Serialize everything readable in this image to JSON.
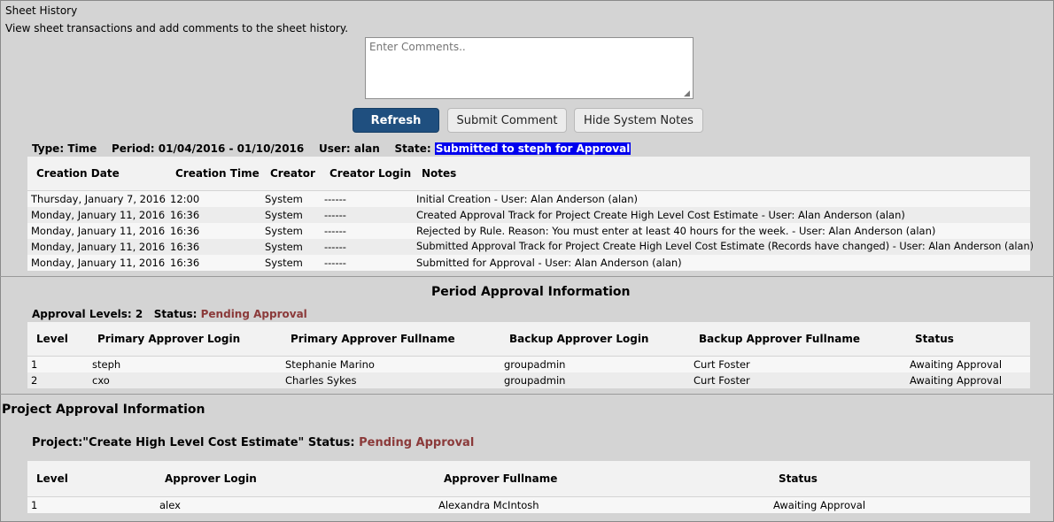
{
  "header": {
    "title": "Sheet History",
    "subtitle": "View sheet transactions and add comments to the sheet history."
  },
  "comment_box": {
    "placeholder": "Enter Comments.."
  },
  "buttons": {
    "refresh": "Refresh",
    "submit_comment": "Submit Comment",
    "hide_system_notes": "Hide System Notes"
  },
  "sheet_info": {
    "type_label": "Type:",
    "type_value": "Time",
    "period_label": "Period:",
    "period_value": "01/04/2016 - 01/10/2016",
    "user_label": "User:",
    "user_value": "alan",
    "state_label": "State:",
    "state_value": "Submitted to steph for Approval"
  },
  "history_table": {
    "headers": [
      "Creation Date",
      "Creation Time",
      "Creator",
      "Creator Login",
      "Notes"
    ],
    "rows": [
      [
        "Thursday, January 7, 2016",
        "12:00",
        "System",
        "------",
        "Initial Creation - User: Alan Anderson (alan)"
      ],
      [
        "Monday, January 11, 2016",
        "16:36",
        "System",
        "------",
        "Created Approval Track for Project Create High Level Cost Estimate - User: Alan Anderson (alan)"
      ],
      [
        "Monday, January 11, 2016",
        "16:36",
        "System",
        "------",
        "Rejected by Rule. Reason: You must enter at least 40 hours for the week. - User: Alan Anderson (alan)"
      ],
      [
        "Monday, January 11, 2016",
        "16:36",
        "System",
        "------",
        "Submitted Approval Track for Project Create High Level Cost Estimate (Records have changed) - User: Alan Anderson (alan)"
      ],
      [
        "Monday, January 11, 2016",
        "16:36",
        "System",
        "------",
        "Submitted for Approval - User: Alan Anderson (alan)"
      ]
    ]
  },
  "period_approval": {
    "title": "Period Approval Information",
    "levels_label": "Approval Levels:",
    "levels_value": "2",
    "status_label": "Status:",
    "status_value": "Pending Approval",
    "headers": [
      "Level",
      "Primary Approver Login",
      "Primary Approver Fullname",
      "Backup Approver Login",
      "Backup Approver Fullname",
      "Status"
    ],
    "rows": [
      [
        "1",
        "steph",
        "Stephanie Marino",
        "groupadmin",
        "Curt Foster",
        "Awaiting Approval"
      ],
      [
        "2",
        "cxo",
        "Charles Sykes",
        "groupadmin",
        "Curt Foster",
        "Awaiting Approval"
      ]
    ]
  },
  "project_approval": {
    "title": "Project Approval Information",
    "project_label": "Project:\"Create High Level Cost Estimate\" Status:",
    "status_value": "Pending Approval",
    "headers": [
      "Level",
      "Approver Login",
      "Approver Fullname",
      "Status"
    ],
    "rows": [
      [
        "1",
        "alex",
        "Alexandra McIntosh",
        "Awaiting Approval"
      ]
    ]
  },
  "colors": {
    "background": "#d4d4d4",
    "primary_button": "#1f4f7f",
    "state_highlight": "#0000ee",
    "pending_status": "#8b3a3a"
  }
}
